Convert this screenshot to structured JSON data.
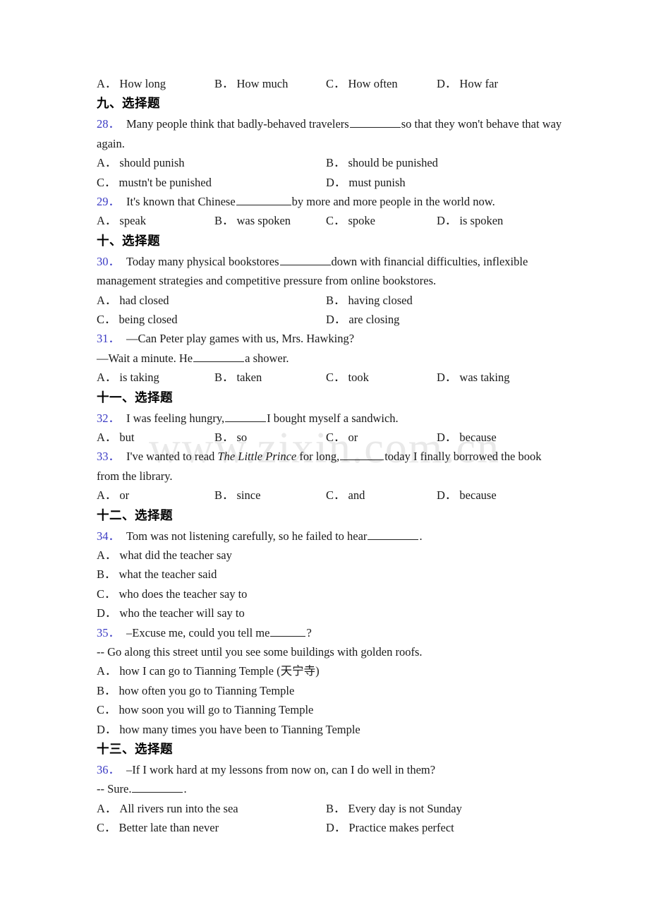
{
  "watermark": {
    "text": "www.zixin.com.cn"
  },
  "document": {
    "top_orphan_options": {
      "name": "orphan-option-row",
      "options": [
        {
          "label": "A",
          "text": "How long"
        },
        {
          "label": "B",
          "text": "How much"
        },
        {
          "label": "C",
          "text": "How often"
        },
        {
          "label": "D",
          "text": "How far"
        }
      ]
    },
    "sections": [
      {
        "heading": "九、选择题",
        "questions": [
          {
            "number": "28",
            "stem_part1": "Many people think that badly-behaved travelers",
            "stem_part2": "so that they won't behave that way",
            "stem_line2": "again.",
            "layout": "two-column",
            "options": [
              {
                "label": "A",
                "text": "should punish"
              },
              {
                "label": "B",
                "text": "should be punished"
              },
              {
                "label": "C",
                "text": "mustn't be punished"
              },
              {
                "label": "D",
                "text": "must punish"
              }
            ]
          },
          {
            "number": "29",
            "stem_part1": "It's known that Chinese",
            "stem_part2": "by more and more people in the world now.",
            "layout": "four-column",
            "options": [
              {
                "label": "A",
                "text": "speak"
              },
              {
                "label": "B",
                "text": "was spoken"
              },
              {
                "label": "C",
                "text": "spoke"
              },
              {
                "label": "D",
                "text": "is spoken"
              }
            ]
          }
        ]
      },
      {
        "heading": "十、选择题",
        "questions": [
          {
            "number": "30",
            "stem_part1": "Today many physical bookstores",
            "stem_part2": "down with financial difficulties, inflexible",
            "stem_line2": "management strategies and competitive pressure from online bookstores.",
            "layout": "two-column",
            "options": [
              {
                "label": "A",
                "text": "had closed"
              },
              {
                "label": "B",
                "text": "having closed"
              },
              {
                "label": "C",
                "text": "being closed"
              },
              {
                "label": "D",
                "text": "are closing"
              }
            ]
          },
          {
            "number": "31",
            "stem_part1": "—Can Peter play games with us, Mrs. Hawking?",
            "stem_line2_part1": "—Wait a minute. He",
            "stem_line2_part2": "a shower.",
            "layout": "four-column",
            "options": [
              {
                "label": "A",
                "text": "is taking"
              },
              {
                "label": "B",
                "text": "taken"
              },
              {
                "label": "C",
                "text": "took"
              },
              {
                "label": "D",
                "text": "was taking"
              }
            ]
          }
        ]
      },
      {
        "heading": "十一、选择题",
        "questions": [
          {
            "number": "32",
            "stem_part1": "I was feeling hungry,",
            "stem_part2": "I bought myself a sandwich.",
            "layout": "four-column",
            "options": [
              {
                "label": "A",
                "text": "but"
              },
              {
                "label": "B",
                "text": "so"
              },
              {
                "label": "C",
                "text": "or"
              },
              {
                "label": "D",
                "text": "because"
              }
            ]
          },
          {
            "number": "33",
            "stem_part1": "I've wanted to read",
            "stem_italic": "The Little Prince",
            "stem_part2": "for long,",
            "stem_part3": "today I finally borrowed the book",
            "stem_line2": "from the library.",
            "layout": "four-column",
            "options": [
              {
                "label": "A",
                "text": "or"
              },
              {
                "label": "B",
                "text": "since"
              },
              {
                "label": "C",
                "text": "and"
              },
              {
                "label": "D",
                "text": "because"
              }
            ]
          }
        ]
      },
      {
        "heading": "十二、选择题",
        "questions": [
          {
            "number": "34",
            "stem_part1": "Tom was not listening carefully, so he failed to hear",
            "stem_part2": ".",
            "layout": "stacked",
            "options": [
              {
                "label": "A",
                "text": "what did the teacher say"
              },
              {
                "label": "B",
                "text": "what the teacher said"
              },
              {
                "label": "C",
                "text": "who does the teacher say to"
              },
              {
                "label": "D",
                "text": "who the teacher will say to"
              }
            ]
          },
          {
            "number": "35",
            "stem_part1": "–Excuse me, could you tell me",
            "stem_part2": "?",
            "stem_line2": "-- Go along this street until you see some buildings with golden roofs.",
            "layout": "stacked",
            "options": [
              {
                "label": "A",
                "text": "how I can go to Tianning Temple (天宁寺)"
              },
              {
                "label": "B",
                "text": "how often you go to Tianning Temple"
              },
              {
                "label": "C",
                "text": "how soon you will go to Tianning Temple"
              },
              {
                "label": "D",
                "text": "how many times you have been to Tianning Temple"
              }
            ]
          }
        ]
      },
      {
        "heading": "十三、选择题",
        "questions": [
          {
            "number": "36",
            "stem_part1": "–If I work hard at my lessons from now on, can I do well in them?",
            "stem_line2_part1": "-- Sure.",
            "stem_line2_part2": ".",
            "layout": "two-column",
            "options": [
              {
                "label": "A",
                "text": "All rivers run into the sea"
              },
              {
                "label": "B",
                "text": "Every day is not Sunday"
              },
              {
                "label": "C",
                "text": "Better late than never"
              },
              {
                "label": "D",
                "text": "Practice makes perfect"
              }
            ]
          }
        ]
      }
    ]
  }
}
